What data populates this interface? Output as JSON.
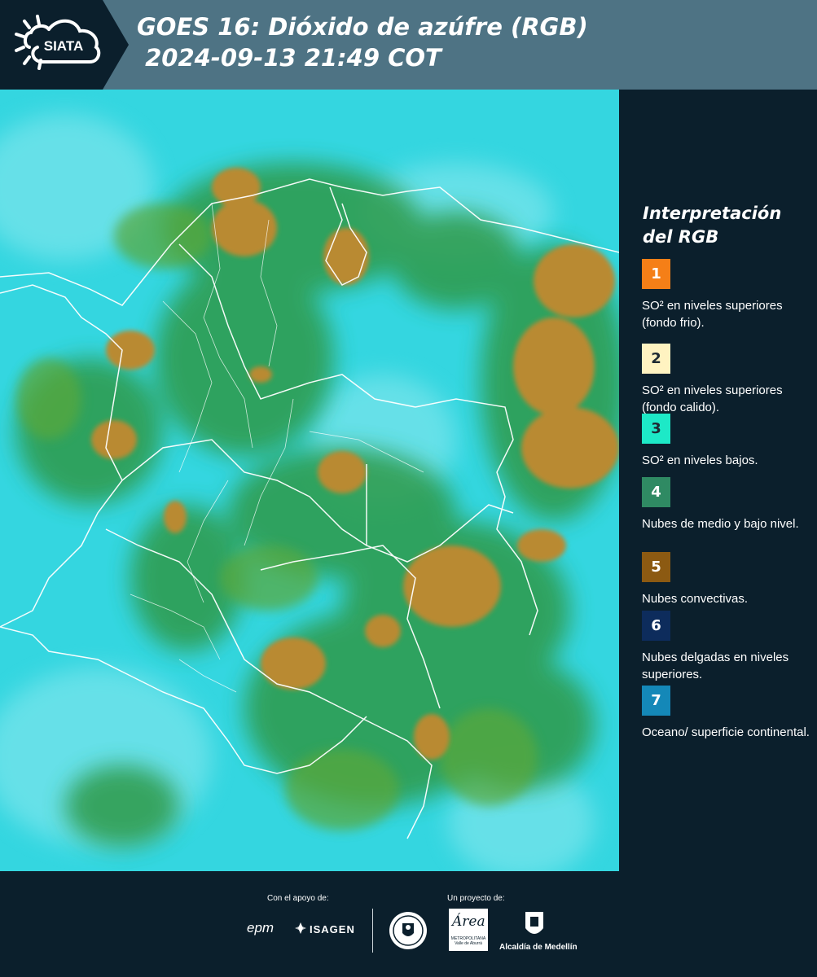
{
  "header": {
    "logo_text": "SIATA",
    "title_line1": "GOES 16: Dióxido de azúfre (RGB)",
    "title_line2": " 2024-09-13 21:49 COT",
    "background_color": "#4e7384"
  },
  "map": {
    "background_color": "#2fd3df"
  },
  "legend": {
    "title": "Interpretación del RGB",
    "items": [
      {
        "number": "1",
        "color": "#f57f17",
        "text_color": "#ffffff",
        "label": "SO² en niveles superiores (fondo frio)."
      },
      {
        "number": "2",
        "color": "#fff3c1",
        "text_color": "#1e2a33",
        "label": "SO² en niveles superiores (fondo calido)."
      },
      {
        "number": "3",
        "color": "#1de9c7",
        "text_color": "#1e2a33",
        "label": "SO² en niveles bajos."
      },
      {
        "number": "4",
        "color": "#2f8a63",
        "text_color": "#ffffff",
        "label": "Nubes de medio y bajo nivel."
      },
      {
        "number": "5",
        "color": "#8c5a12",
        "text_color": "#ffffff",
        "label": "Nubes convectivas."
      },
      {
        "number": "6",
        "color": "#0d2c5c",
        "text_color": "#ffffff",
        "label": "Nubes delgadas en niveles superiores."
      },
      {
        "number": "7",
        "color": "#1488b8",
        "text_color": "#ffffff",
        "label": "Oceano/ superficie continental."
      }
    ]
  },
  "footer": {
    "support_label": "Con el apoyo de:",
    "project_label": "Un proyecto de:",
    "sponsors": {
      "epm": "epm",
      "isagen": "ISAGEN",
      "area": "Área",
      "area_sub": "METROPOLITANA Valle de Aburrá",
      "alcaldia": "Alcaldía de Medellín"
    }
  }
}
